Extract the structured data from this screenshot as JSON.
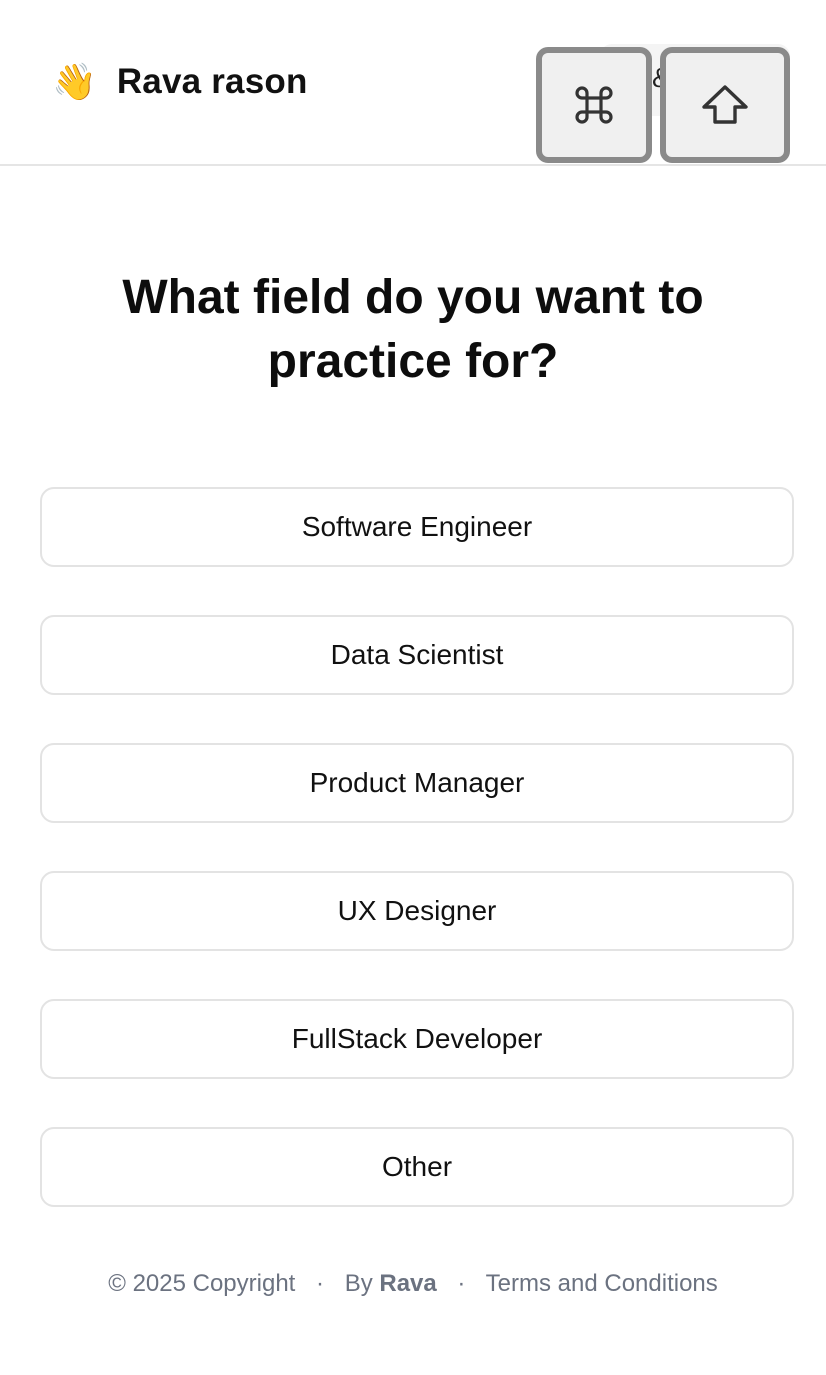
{
  "header": {
    "brand_emoji": "👋",
    "brand_name": "Rava rason",
    "partial_glyph": "&",
    "keycaps": [
      {
        "icon": "command-key-icon",
        "symbol": "⌘"
      },
      {
        "icon": "shift-key-icon",
        "symbol": "⇧"
      }
    ]
  },
  "main": {
    "title_line1": "What field do you want to",
    "title_line2": "practice for?",
    "options": [
      {
        "label": "Software Engineer"
      },
      {
        "label": "Data Scientist"
      },
      {
        "label": "Product Manager"
      },
      {
        "label": "UX Designer"
      },
      {
        "label": "FullStack Developer"
      },
      {
        "label": "Other"
      }
    ]
  },
  "footer": {
    "copyright": "© 2025 Copyright",
    "separator": "·",
    "by_prefix": "By",
    "by_name": "Rava",
    "terms": "Terms and Conditions"
  },
  "colors": {
    "text": "#111111",
    "border": "#e3e3e3",
    "muted": "#6b7280",
    "keycap_border": "#8a8a8a",
    "keycap_fill": "#f0f0f0"
  }
}
